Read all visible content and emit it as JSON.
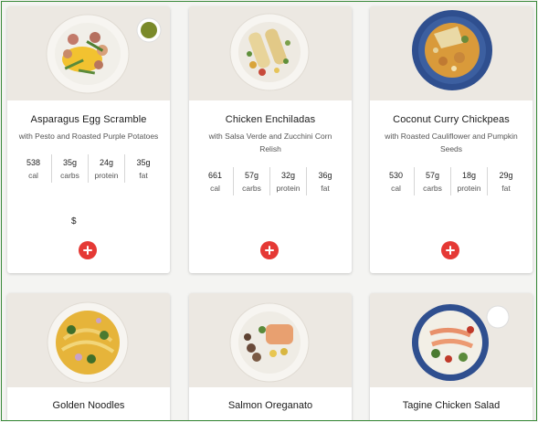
{
  "meals": [
    {
      "title": "Asparagus Egg Scramble",
      "subtitle": "with Pesto and Roasted Purple Potatoes",
      "macros": [
        {
          "value": "538",
          "label": "cal"
        },
        {
          "value": "35g",
          "label": "carbs"
        },
        {
          "value": "24g",
          "label": "protein"
        },
        {
          "value": "35g",
          "label": "fat"
        }
      ],
      "price": "$",
      "image_icon": "meal-photo-icon"
    },
    {
      "title": "Chicken Enchiladas",
      "subtitle": "with Salsa Verde and Zucchini Corn Relish",
      "macros": [
        {
          "value": "661",
          "label": "cal"
        },
        {
          "value": "57g",
          "label": "carbs"
        },
        {
          "value": "32g",
          "label": "protein"
        },
        {
          "value": "36g",
          "label": "fat"
        }
      ],
      "image_icon": "meal-photo-icon"
    },
    {
      "title": "Coconut Curry Chickpeas",
      "subtitle": "with Roasted Cauliflower and Pumpkin Seeds",
      "macros": [
        {
          "value": "530",
          "label": "cal"
        },
        {
          "value": "57g",
          "label": "carbs"
        },
        {
          "value": "18g",
          "label": "protein"
        },
        {
          "value": "29g",
          "label": "fat"
        }
      ],
      "image_icon": "meal-photo-icon"
    },
    {
      "title": "Golden Noodles",
      "image_icon": "meal-photo-icon"
    },
    {
      "title": "Salmon Oreganato",
      "image_icon": "meal-photo-icon"
    },
    {
      "title": "Tagine Chicken Salad",
      "image_icon": "meal-photo-icon"
    }
  ],
  "add_icon": "plus-icon",
  "colors": {
    "accent": "#e53935",
    "background": "#f4f4f2",
    "card": "#ffffff",
    "frame_border": "#3a8a3a"
  }
}
